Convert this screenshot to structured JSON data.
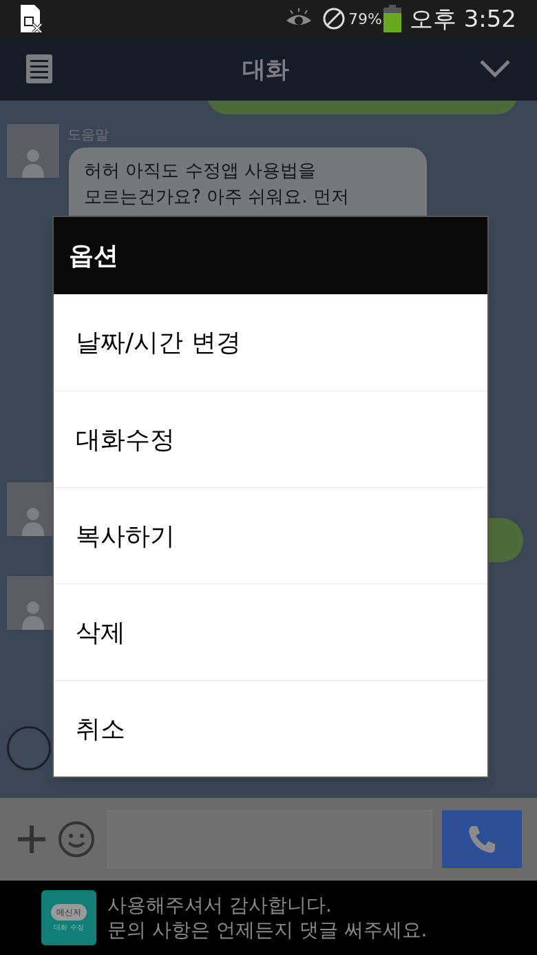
{
  "status_bar": {
    "battery": "79%",
    "time": "오후 3:52"
  },
  "app_bar": {
    "title": "대화"
  },
  "messages": [
    {
      "sender": "도움말",
      "lines": [
        "허허 아직도 수정앱 사용법을",
        "모르는건가요? 아주 쉬워요. 먼저"
      ]
    }
  ],
  "dialog": {
    "title": "옵션",
    "items": [
      "날짜/시간 변경",
      "대화수정",
      "복사하기",
      "삭제",
      "취소"
    ]
  },
  "ad": {
    "icon_top": "메신저",
    "icon_bottom": "대화 수정",
    "lines": [
      "사용해주셔서 감사합니다.",
      "문의 사항은 언제든지 댓글 써주세요."
    ]
  }
}
